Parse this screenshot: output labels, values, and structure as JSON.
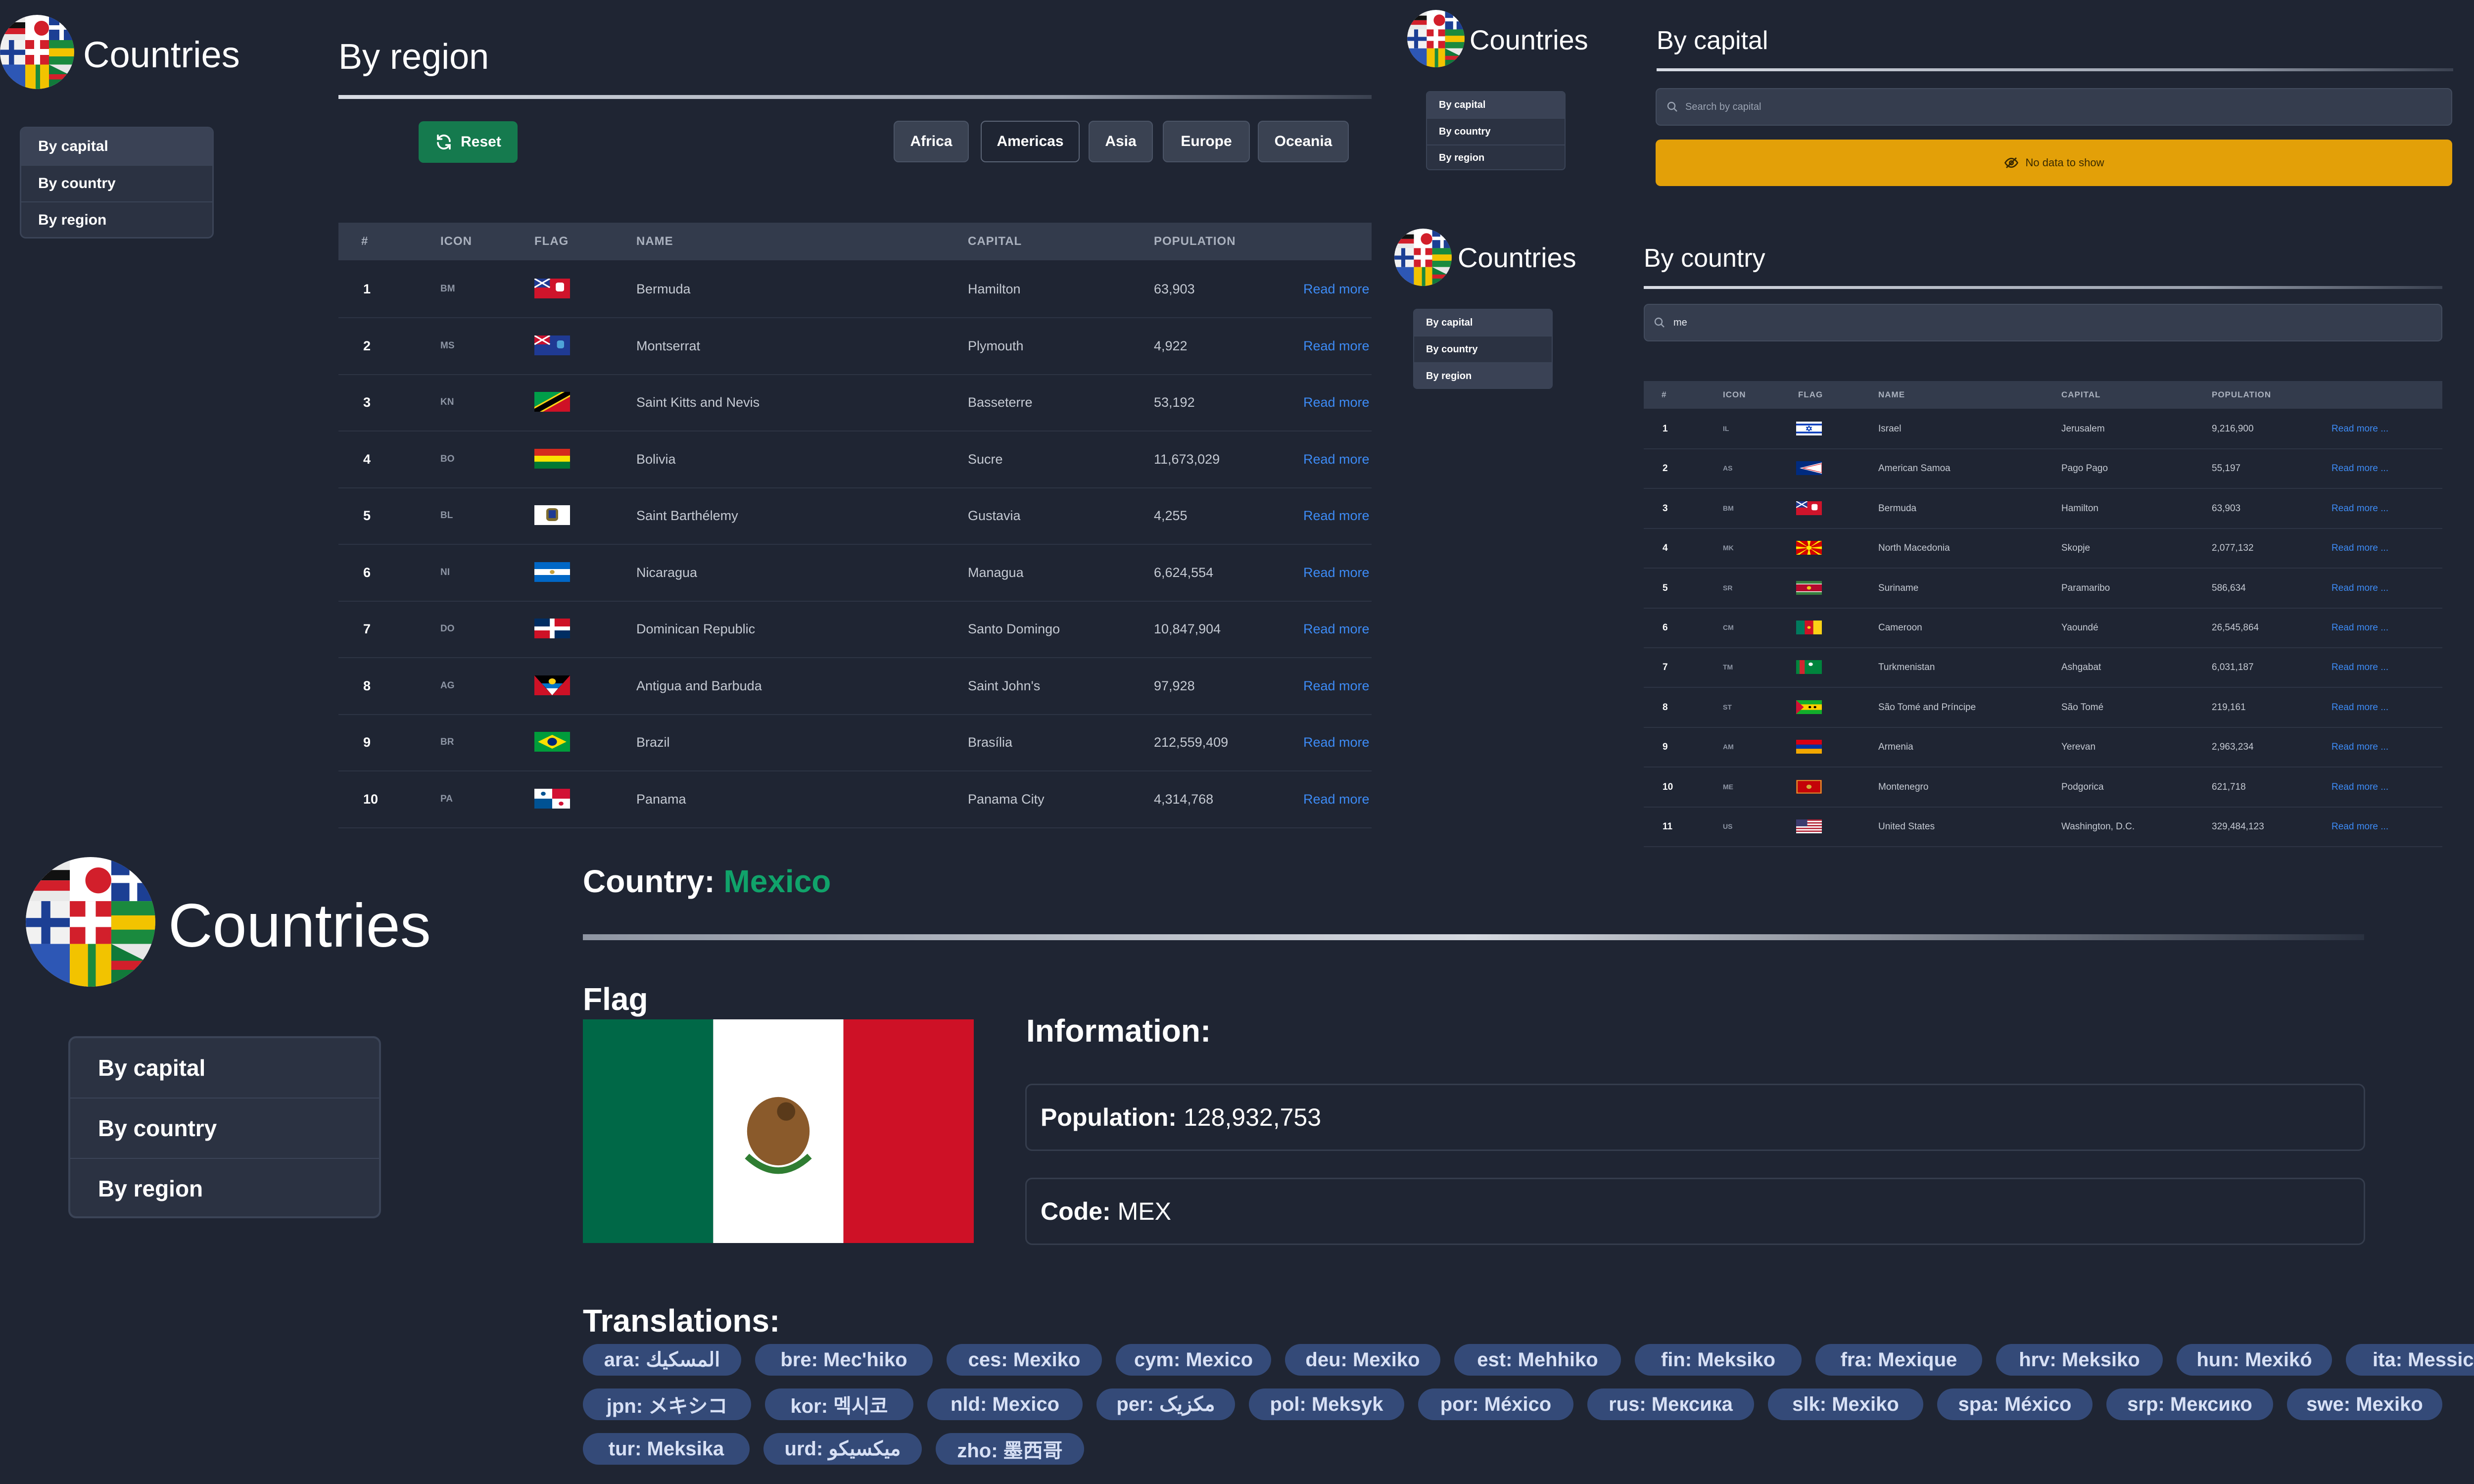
{
  "app": {
    "brand": "Countries"
  },
  "nav": {
    "items": [
      "By capital",
      "By country",
      "By region"
    ]
  },
  "region_view": {
    "title": "By region",
    "reset_label": "Reset",
    "regions": [
      "Africa",
      "Americas",
      "Asia",
      "Europe",
      "Oceania"
    ],
    "columns": [
      "#",
      "ICON",
      "FLAG",
      "NAME",
      "CAPITAL",
      "POPULATION"
    ],
    "link_label": "Read more",
    "rows": [
      {
        "n": "1",
        "code": "BM",
        "name": "Bermuda",
        "capital": "Hamilton",
        "population": "63,903"
      },
      {
        "n": "2",
        "code": "MS",
        "name": "Montserrat",
        "capital": "Plymouth",
        "population": "4,922"
      },
      {
        "n": "3",
        "code": "KN",
        "name": "Saint Kitts and Nevis",
        "capital": "Basseterre",
        "population": "53,192"
      },
      {
        "n": "4",
        "code": "BO",
        "name": "Bolivia",
        "capital": "Sucre",
        "population": "11,673,029"
      },
      {
        "n": "5",
        "code": "BL",
        "name": "Saint Barthélemy",
        "capital": "Gustavia",
        "population": "4,255"
      },
      {
        "n": "6",
        "code": "NI",
        "name": "Nicaragua",
        "capital": "Managua",
        "population": "6,624,554"
      },
      {
        "n": "7",
        "code": "DO",
        "name": "Dominican Republic",
        "capital": "Santo Domingo",
        "population": "10,847,904"
      },
      {
        "n": "8",
        "code": "AG",
        "name": "Antigua and Barbuda",
        "capital": "Saint John's",
        "population": "97,928"
      },
      {
        "n": "9",
        "code": "BR",
        "name": "Brazil",
        "capital": "Brasília",
        "population": "212,559,409"
      },
      {
        "n": "10",
        "code": "PA",
        "name": "Panama",
        "capital": "Panama City",
        "population": "4,314,768"
      }
    ]
  },
  "capital_view": {
    "title": "By capital",
    "search_placeholder": "Search by capital",
    "no_data": "No data to show"
  },
  "country_view": {
    "title": "By country",
    "search_value": "me",
    "columns": [
      "#",
      "ICON",
      "FLAG",
      "NAME",
      "CAPITAL",
      "POPULATION"
    ],
    "link_label": "Read more ...",
    "rows": [
      {
        "n": "1",
        "code": "IL",
        "name": "Israel",
        "capital": "Jerusalem",
        "population": "9,216,900"
      },
      {
        "n": "2",
        "code": "AS",
        "name": "American Samoa",
        "capital": "Pago Pago",
        "population": "55,197"
      },
      {
        "n": "3",
        "code": "BM",
        "name": "Bermuda",
        "capital": "Hamilton",
        "population": "63,903"
      },
      {
        "n": "4",
        "code": "MK",
        "name": "North Macedonia",
        "capital": "Skopje",
        "population": "2,077,132"
      },
      {
        "n": "5",
        "code": "SR",
        "name": "Suriname",
        "capital": "Paramaribo",
        "population": "586,634"
      },
      {
        "n": "6",
        "code": "CM",
        "name": "Cameroon",
        "capital": "Yaoundé",
        "population": "26,545,864"
      },
      {
        "n": "7",
        "code": "TM",
        "name": "Turkmenistan",
        "capital": "Ashgabat",
        "population": "6,031,187"
      },
      {
        "n": "8",
        "code": "ST",
        "name": "São Tomé and Príncipe",
        "capital": "São Tomé",
        "population": "219,161"
      },
      {
        "n": "9",
        "code": "AM",
        "name": "Armenia",
        "capital": "Yerevan",
        "population": "2,963,234"
      },
      {
        "n": "10",
        "code": "ME",
        "name": "Montenegro",
        "capital": "Podgorica",
        "population": "621,718"
      },
      {
        "n": "11",
        "code": "US",
        "name": "United States",
        "capital": "Washington, D.C.",
        "population": "329,484,123"
      }
    ]
  },
  "detail_view": {
    "title_prefix": "Country:",
    "country_name": "Mexico",
    "flag_heading": "Flag",
    "info_heading": "Information:",
    "population_label": "Population:",
    "population_value": "128,932,753",
    "code_label": "Code:",
    "code_value": "MEX",
    "translations_heading": "Translations:",
    "translations": [
      "ara: المسكيك",
      "bre: Mec'hiko",
      "ces: Mexiko",
      "cym: Mexico",
      "deu: Mexiko",
      "est: Mehhiko",
      "fin: Meksiko",
      "fra: Mexique",
      "hrv: Meksiko",
      "hun: Mexikó",
      "ita: Messico",
      "jpn: メキシコ",
      "kor: 멕시코",
      "nld: Mexico",
      "per: مکزیک",
      "pol: Meksyk",
      "por: México",
      "rus: Мексика",
      "slk: Mexiko",
      "spa: México",
      "srp: Мексико",
      "swe: Mexiko",
      "tur: Meksika",
      "urd: میکسیکو",
      "zho: 墨西哥"
    ]
  },
  "colors": {
    "background": "#1f2533",
    "accent_green": "#10a36a",
    "link_blue": "#3d8bf5",
    "warning": "#e3a008",
    "tag": "#344a78"
  }
}
